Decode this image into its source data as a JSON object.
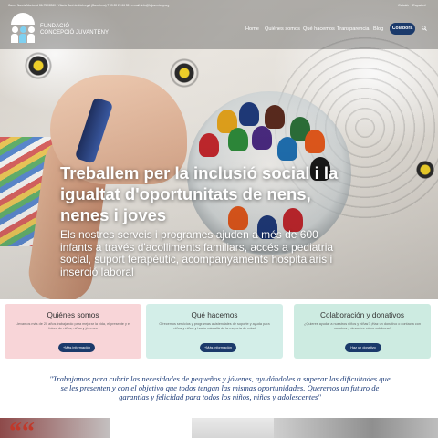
{
  "header": {
    "contact": "Carrer Narcís Monturiol 86-75 08960 • Vilaviu Sant de Llobregat (Barcelona) T 93 89 29 66 55 • e-mail: info@fcijuventeny.org",
    "languages": [
      "Català",
      "Español"
    ],
    "logo": {
      "line1": "FUNDACIÓ",
      "line2": "CONCEPCIÓ JUVANTENY"
    },
    "nav": [
      {
        "label": "Home"
      },
      {
        "label": "Quiénes somos"
      },
      {
        "label": "Qué hacemos"
      },
      {
        "label": "Transparencia"
      },
      {
        "label": "Blog"
      }
    ],
    "cta": "Colabora",
    "search_icon": "search-icon"
  },
  "hero": {
    "title": "Treballem per la inclusió social i la igualtat d'oportunitats de nens, nenes i joves",
    "subtitle": "Els nostres serveis i programes ajuden a més de 600 infants a través d'acolliments familiars, accés a pediatria social, suport terapèutic, acompanyaments hospitalaris i inserció laboral"
  },
  "cards": [
    {
      "title": "Quiénes somos",
      "text": "Llevamos más de 20 años trabajando para mejorar la vida, el presente y el futuro de niños, niñas y jóvenes",
      "button": "+Más información",
      "bg": "#f8d5d8"
    },
    {
      "title": "Qué hacemos",
      "text": "Ofrecemos servicios y programas asistenciales de soporte y ayuda para niños y niñas y hasta más allá de la mayoría de edad",
      "button": "+Más información",
      "bg": "#d3eee8"
    },
    {
      "title": "Colaboración y donativos",
      "text": "¿Quieres ayudar a nuestros niños y niñas? ¡Haz un donativo o contacta con nosotros y descubre cómo colaborar!",
      "button": "Haz un donativo",
      "bg": "#cdebe1"
    }
  ],
  "quote": "\"Trabajamos para cubrir las necesidades de pequeños y jóvenes, ayudándoles a superar las dificultades que se les presenten y con el objetivo que todos tengan las mismas oportunidades. Queremos un futuro de garantías y felicidad para todos los niños, niñas y adolescentes\"",
  "bottom": {
    "quote_glyph": "““"
  },
  "colors": {
    "navy": "#1b3a6b",
    "quote_blue": "#1d3c78",
    "accent_red": "#c0392b"
  }
}
